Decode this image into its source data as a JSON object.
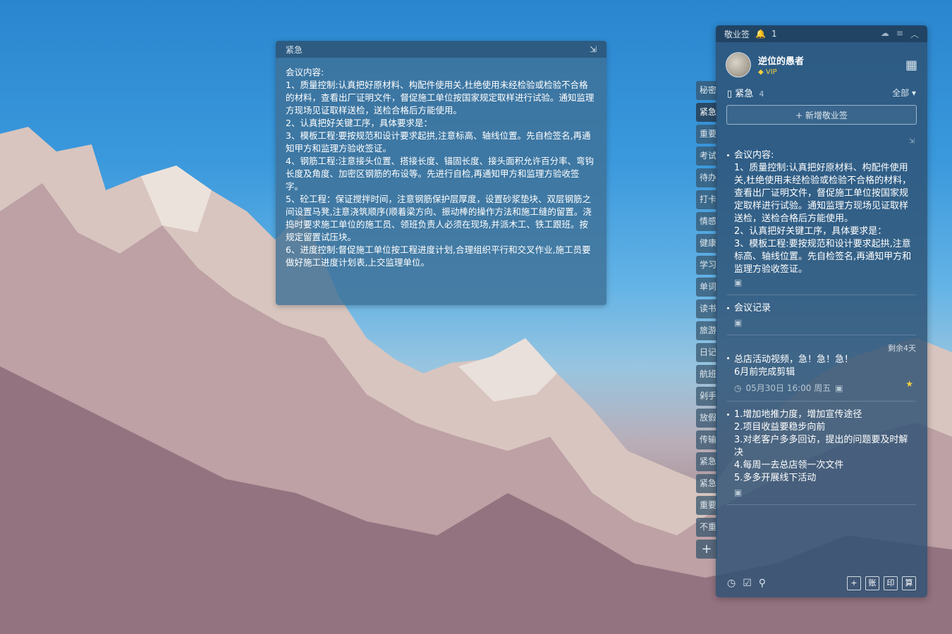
{
  "float_note": {
    "title": "紧急",
    "content": "会议内容:\n1、质量控制:认真把好原材料、构配件使用关,杜绝使用未经检验或检验不合格的材料，查看出厂证明文件，督促施工单位按国家规定取样进行试验。通知监理\n方现场见证取样送检，送检合格后方能使用。\n2、认真把好关键工序，具体要求是：\n3、模板工程:要按规范和设计要求起拱,注意标高、轴线位置。先自检签名,再通知甲方和监理方验收签证。\n4、钢筋工程:注意接头位置、搭接长度、锚固长度、接头面积允许百分率、弯钩长度及角度、加密区钢筋的布设等。先进行自检,再通知甲方和监理方验收签字。\n5、砼工程：保证搅拌时间，注意钢筋保护层厚度，设置砂浆垫块、双层钢筋之间设置马凳,注意浇筑顺序(顺着梁方向、振动棒的操作方法和施工缝的留置。浇捣时要求施工单位的施工员、领班负责人必须在现场,并派木工、铁工跟班。按规定留置试压块。\n6、进度控制:督促施工单位按工程进度计划,合理组织平行和交叉作业,施工员要做好施工进度计划表,上交监理单位。"
  },
  "side_tabs": [
    "秘密",
    "紧急",
    "重要",
    "考试",
    "待办",
    "打卡",
    "情感",
    "健康",
    "学习",
    "单词",
    "读书",
    "旅游",
    "日记",
    "航班",
    "剁手",
    "放假",
    "传输",
    "紧急",
    "紧急",
    "重要",
    "不重"
  ],
  "side_tabs_active_index": 1,
  "panel": {
    "app_name": "敬业签",
    "notif_count": "1",
    "user_name": "逆位的愚者",
    "vip_label": "VIP",
    "category": "紧急",
    "category_count": "4",
    "filter_label": "全部",
    "add_label": "+ 新增敬业签",
    "items": [
      {
        "text": "会议内容:\n1、质量控制:认真把好原材料、构配件使用关,杜绝使用未经检验或检验不合格的材料，查看出厂证明文件，督促施工单位按国家规定取样进行试验。通知监理方现场见证取样送检，送检合格后方能使用。\n2、认真把好关键工序，具体要求是：\n3、模板工程:要按规范和设计要求起拱,注意标高、轴线位置。先自检签名,再通知甲方和监理方验收签证。"
      },
      {
        "text": "会议记录"
      },
      {
        "remain": "剩余4天",
        "text": "总店活动视频，急！急！急！\n6月前完成剪辑",
        "datetime": "05月30日 16:00 周五"
      },
      {
        "text": "1.增加地推力度，增加宣传途径\n2.项目收益要稳步向前\n3.对老客户多多回访，提出的问题要及时解决\n4.每周一去总店领一次文件\n5.多多开展线下活动"
      }
    ],
    "bottom_buttons": [
      "账",
      "印",
      "算"
    ]
  }
}
